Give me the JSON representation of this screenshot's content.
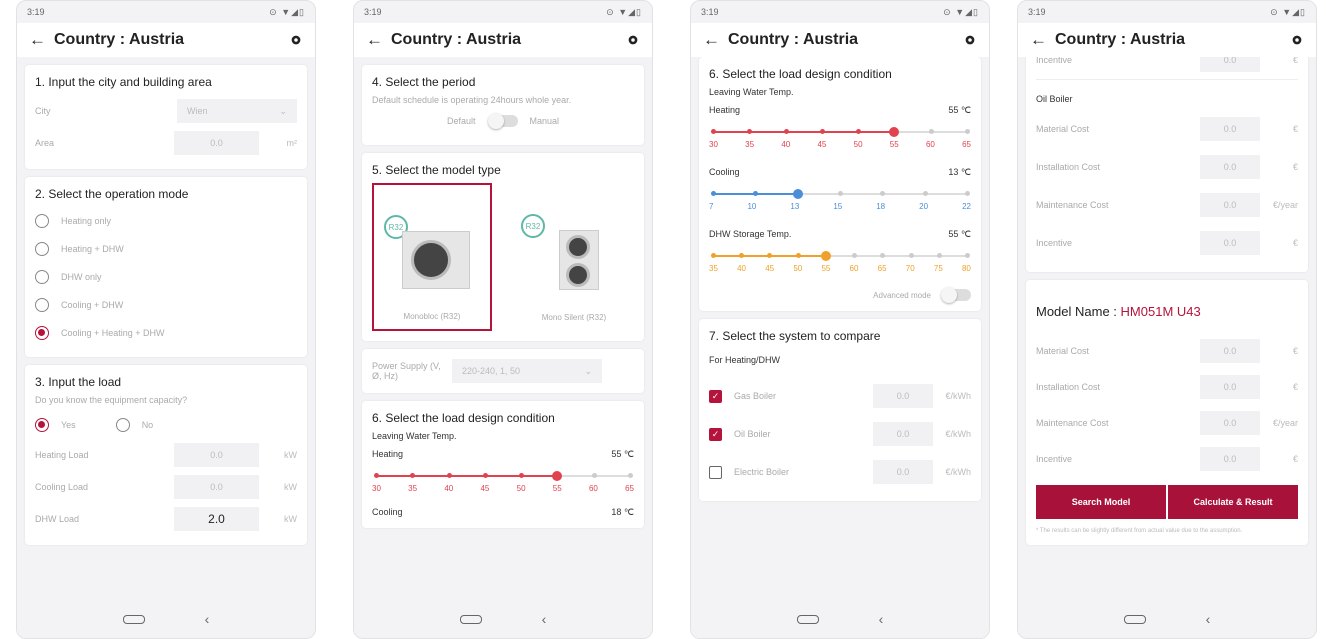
{
  "status": {
    "time": "3:19",
    "time2": "3:19",
    "icons": "⊙ ▼◢▯"
  },
  "appbar": {
    "title": "Country : Austria",
    "back": "←"
  },
  "colors": {
    "accent": "#b5133c",
    "heating": "#e0434f",
    "cooling": "#4a8fd8",
    "dhw": "#f0a12a"
  },
  "s1": {
    "title": "1. Input the city and building area",
    "city_label": "City",
    "city_value": "Wien",
    "area_label": "Area",
    "area_value": "0.0",
    "area_unit": "m²"
  },
  "s2": {
    "title": "2. Select the operation mode",
    "options": [
      "Heating only",
      "Heating + DHW",
      "DHW only",
      "Cooling + DHW",
      "Cooling + Heating + DHW"
    ],
    "selected": 4
  },
  "s3": {
    "title": "3. Input the load",
    "question": "Do you know the equipment capacity?",
    "yes": "Yes",
    "no": "No",
    "rows": [
      {
        "label": "Heating Load",
        "value": "0.0",
        "unit": "kW"
      },
      {
        "label": "Cooling Load",
        "value": "0.0",
        "unit": "kW"
      },
      {
        "label": "DHW Load",
        "value": "2.0",
        "unit": "kW"
      }
    ]
  },
  "s4": {
    "title": "4. Select the period",
    "desc": "Default schedule is operating 24hours whole year.",
    "default": "Default",
    "manual": "Manual"
  },
  "s5": {
    "title": "5. Select the model type",
    "m1": "Monobloc (R32)",
    "m2": "Mono Silent (R32)",
    "badge": "R32",
    "ps_label": "Power Supply (V, Ø, Hz)",
    "ps_value": "220-240, 1, 50"
  },
  "s6": {
    "title": "6. Select the load design condition",
    "lwt": "Leaving Water Temp.",
    "heating": {
      "label": "Heating",
      "value": "55",
      "unit": "℃",
      "ticks": [
        "30",
        "35",
        "40",
        "45",
        "50",
        "55",
        "60",
        "65"
      ],
      "level": 0.714
    },
    "cooling": {
      "label": "Cooling",
      "value": "13",
      "unit": "℃",
      "ticks": [
        "7",
        "10",
        "13",
        "15",
        "18",
        "20",
        "22"
      ],
      "level": 0.333
    },
    "dhw": {
      "label": "DHW Storage Temp.",
      "value": "55",
      "unit": "℃",
      "ticks": [
        "35",
        "40",
        "45",
        "50",
        "55",
        "60",
        "65",
        "70",
        "75",
        "80"
      ],
      "level": 0.444
    },
    "cooling_cut": "Cooling",
    "cooling_cut_val": "18 ℃",
    "advanced": "Advanced mode"
  },
  "s7": {
    "title": "7. Select the system to compare",
    "sub": "For Heating/DHW",
    "rows": [
      {
        "label": "Gas Boiler",
        "value": "0.0",
        "unit": "€/kWh",
        "checked": true
      },
      {
        "label": "Oil Boiler",
        "value": "0.0",
        "unit": "€/kWh",
        "checked": true
      },
      {
        "label": "Electric Boiler",
        "value": "0.0",
        "unit": "€/kWh",
        "checked": false
      }
    ]
  },
  "p4": {
    "top_label": "Incentive",
    "top_value": "0.0",
    "top_unit": "€",
    "oil_title": "Oil Boiler",
    "oil_rows": [
      {
        "label": "Material Cost",
        "value": "0.0",
        "unit": "€"
      },
      {
        "label": "Installation Cost",
        "value": "0.0",
        "unit": "€"
      },
      {
        "label": "Maintenance Cost",
        "value": "0.0",
        "unit": "€/year"
      },
      {
        "label": "Incentive",
        "value": "0.0",
        "unit": "€"
      }
    ],
    "model_label": "Model Name : ",
    "model_value": "HM051M U43",
    "model_rows": [
      {
        "label": "Material Cost",
        "value": "0.0",
        "unit": "€"
      },
      {
        "label": "Installation Cost",
        "value": "0.0",
        "unit": "€"
      },
      {
        "label": "Maintenance Cost",
        "value": "0.0",
        "unit": "€/year"
      },
      {
        "label": "Incentive",
        "value": "0.0",
        "unit": "€"
      }
    ],
    "btn_search": "Search Model",
    "btn_calc": "Calculate & Result",
    "note": "* The results can be slightly different from actual value due to the assumption."
  }
}
